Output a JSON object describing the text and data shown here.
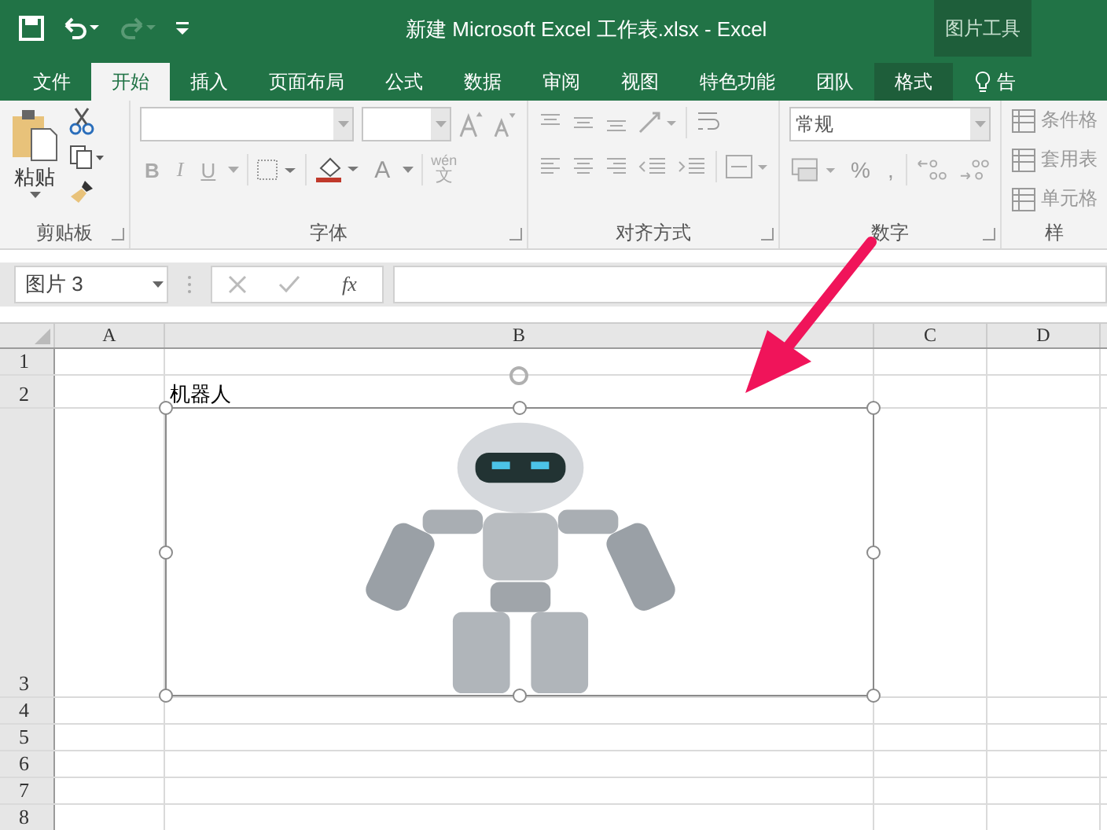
{
  "window": {
    "title": "新建 Microsoft Excel 工作表.xlsx - Excel",
    "context_group": "图片工具"
  },
  "quick_access": [
    {
      "kind": "save",
      "disabled": false
    },
    {
      "kind": "undo",
      "disabled": false
    },
    {
      "kind": "redo",
      "disabled": true
    },
    {
      "kind": "customize",
      "disabled": false
    }
  ],
  "tabs": [
    {
      "label": "文件",
      "selected": false,
      "contextual": false
    },
    {
      "label": "开始",
      "selected": true,
      "contextual": false
    },
    {
      "label": "插入",
      "selected": false,
      "contextual": false
    },
    {
      "label": "页面布局",
      "selected": false,
      "contextual": false
    },
    {
      "label": "公式",
      "selected": false,
      "contextual": false
    },
    {
      "label": "数据",
      "selected": false,
      "contextual": false
    },
    {
      "label": "审阅",
      "selected": false,
      "contextual": false
    },
    {
      "label": "视图",
      "selected": false,
      "contextual": false
    },
    {
      "label": "特色功能",
      "selected": false,
      "contextual": false
    },
    {
      "label": "团队",
      "selected": false,
      "contextual": false
    },
    {
      "label": "格式",
      "selected": false,
      "contextual": true
    }
  ],
  "tell_me": "告",
  "ribbon": {
    "clipboard": {
      "paste": "粘贴",
      "label": "剪贴板"
    },
    "font": {
      "bold": "B",
      "italic": "I",
      "underline": "U",
      "font_color": "A",
      "phonetic_top": "wén",
      "phonetic_bottom": "文",
      "label": "字体"
    },
    "alignment": {
      "label": "对齐方式"
    },
    "number": {
      "format": "常规",
      "percent": "%",
      "comma": ",",
      "label": "数字"
    },
    "styles": {
      "items": [
        "条件格",
        "套用表",
        "单元格"
      ],
      "label": "样"
    }
  },
  "formula_bar": {
    "name_box": "图片 3",
    "fx": "fx"
  },
  "sheet": {
    "columns": [
      "A",
      "B",
      "C",
      "D"
    ],
    "rows": [
      {
        "label": "1",
        "cells": [
          null,
          null,
          null,
          null
        ]
      },
      {
        "label": "2",
        "cells": [
          null,
          "机器人",
          null,
          null
        ]
      },
      {
        "label": "3",
        "cells": [
          null,
          null,
          null,
          null
        ]
      },
      {
        "label": "4",
        "cells": [
          null,
          null,
          null,
          null
        ]
      },
      {
        "label": "5",
        "cells": [
          null,
          null,
          null,
          null
        ]
      },
      {
        "label": "6",
        "cells": [
          null,
          null,
          null,
          null
        ]
      },
      {
        "label": "7",
        "cells": [
          null,
          null,
          null,
          null
        ]
      },
      {
        "label": "8",
        "cells": [
          null,
          null,
          null,
          null
        ]
      }
    ],
    "picture": {
      "selected": true
    }
  }
}
